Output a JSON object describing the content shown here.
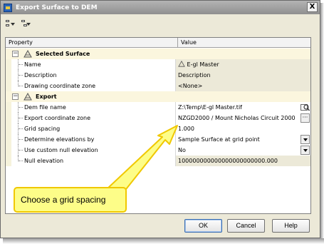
{
  "window": {
    "title": "Export Surface to DEM",
    "close_glyph": "X"
  },
  "toolbar": {
    "icons": [
      "toggle-categorized-icon",
      "toggle-alphabetic-icon"
    ]
  },
  "grid": {
    "col_property": "Property",
    "col_value": "Value",
    "categories": [
      {
        "label": "Selected Surface",
        "expander": "−",
        "rows": [
          {
            "name": "Name",
            "value": "E-gl Master",
            "style": "ro"
          },
          {
            "name": "Description",
            "value": "Description",
            "style": "ro"
          },
          {
            "name": "Drawing coordinate zone",
            "value": "<None>",
            "style": "ro"
          }
        ]
      },
      {
        "label": "Export",
        "expander": "−",
        "rows": [
          {
            "name": "Dem file name",
            "value": "Z:\\Temp\\E-gl Master.tif",
            "style": "ed"
          },
          {
            "name": "Export coordinate zone",
            "value": "NZGD2000 / Mount Nicholas Circuit 2000",
            "style": "ed"
          },
          {
            "name": "Grid spacing",
            "value": "1.000",
            "style": "ed"
          },
          {
            "name": "Determine elevations by",
            "value": "Sample Surface at grid point",
            "style": "ed"
          },
          {
            "name": "Use custom null elevation",
            "value": "No",
            "style": "ed"
          },
          {
            "name": "Null elevation",
            "value": "100000000000000000000000.000",
            "style": "ro"
          }
        ]
      }
    ]
  },
  "buttons": {
    "ok": "OK",
    "cancel": "Cancel",
    "help": "Help"
  },
  "callout": {
    "text": "Choose a grid spacing"
  },
  "colors": {
    "callout_fill": "#fdfd88",
    "callout_border": "#f0c800",
    "category_bg": "#fbf6de"
  }
}
